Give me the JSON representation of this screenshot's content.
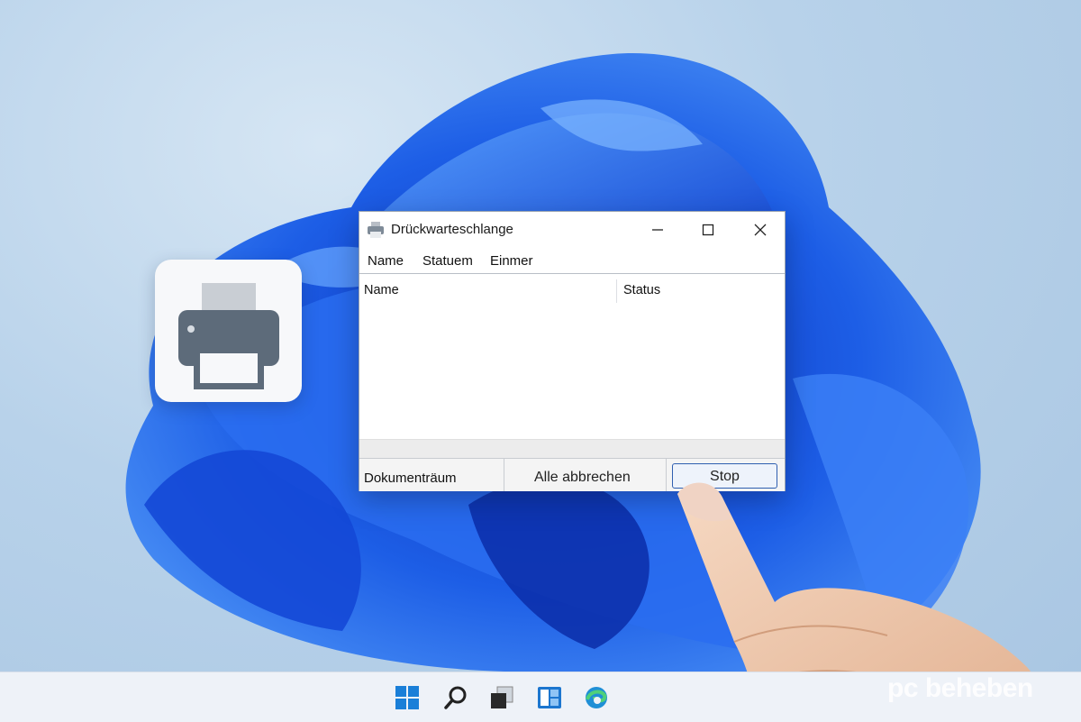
{
  "window": {
    "title": "Drückwarteschlange",
    "menu": [
      "Name",
      "Statuem",
      "Einmer"
    ],
    "columns": [
      "Name",
      "Status"
    ],
    "statusbar": {
      "documents_label": "Dokumenträum",
      "cancel_all_label": "Alle abbrechen",
      "stop_label": "Stop"
    },
    "controls": {
      "minimize": "minimize-icon",
      "maximize": "maximize-icon",
      "close": "close-icon"
    }
  },
  "desktop": {
    "app_tile_icon": "printer-icon"
  },
  "taskbar": {
    "icons": [
      "windows-start-icon",
      "search-icon",
      "task-view-icon",
      "widgets-icon",
      "edge-icon"
    ]
  },
  "watermark": "pc beheben",
  "colors": {
    "accent": "#2f5fb0",
    "wallpaper_blue": "#1f5fe0",
    "printer_gray": "#5d6b7a"
  }
}
